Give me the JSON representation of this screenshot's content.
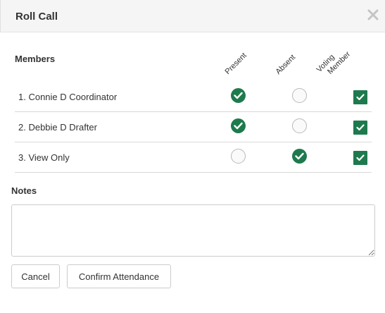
{
  "dialog": {
    "title": "Roll Call",
    "close_icon": "close-icon"
  },
  "members": {
    "label": "Members",
    "columns": {
      "present": "Present",
      "absent": "Absent",
      "voting_line1": "Voting",
      "voting_line2": "Member"
    },
    "rows": [
      {
        "name": "1. Connie D Coordinator",
        "status": "present",
        "voting": true
      },
      {
        "name": "2. Debbie D Drafter",
        "status": "present",
        "voting": true
      },
      {
        "name": "3. View Only",
        "status": "absent",
        "voting": true
      }
    ]
  },
  "notes": {
    "label": "Notes",
    "value": "",
    "placeholder": ""
  },
  "buttons": {
    "cancel": "Cancel",
    "confirm": "Confirm Attendance"
  },
  "colors": {
    "accent": "#1e7a4d",
    "header_bg": "#f5f5f5",
    "border": "#d9d9d9"
  }
}
